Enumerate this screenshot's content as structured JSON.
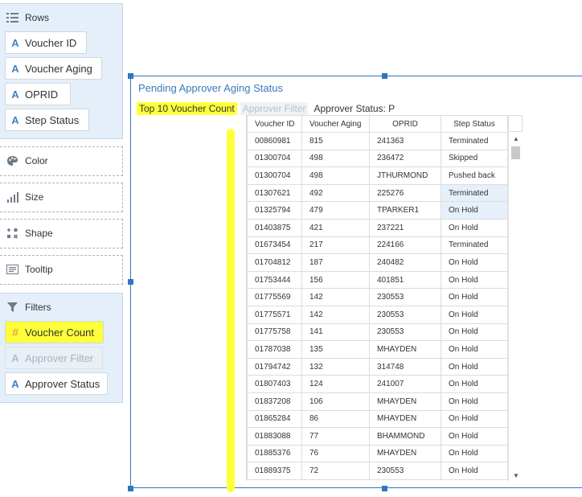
{
  "rows": {
    "header": "Rows",
    "items": [
      "Voucher ID",
      "Voucher Aging",
      "OPRID",
      "Step Status"
    ]
  },
  "marks": {
    "color": "Color",
    "size": "Size",
    "shape": "Shape",
    "tooltip": "Tooltip"
  },
  "filters": {
    "header": "Filters",
    "voucher_count": "Voucher Count",
    "approver_filter": "Approver Filter",
    "approver_status": "Approver Status"
  },
  "viz": {
    "title": "Pending Approver Aging Status",
    "filter_chip": "Top 10 Voucher Count",
    "disabled_chip": "Approver Filter",
    "status_chip": "Approver Status: P"
  },
  "table": {
    "columns": [
      "Voucher ID",
      "Voucher Aging",
      "OPRID",
      "Step Status"
    ],
    "rows": [
      [
        "00860981",
        "815",
        "241363",
        "Terminated"
      ],
      [
        "01300704",
        "498",
        "236472",
        "Skipped"
      ],
      [
        "01300704",
        "498",
        "JTHURMOND",
        "Pushed back"
      ],
      [
        "01307621",
        "492",
        "225276",
        "Terminated"
      ],
      [
        "01325794",
        "479",
        "TPARKER1",
        "On Hold"
      ],
      [
        "01403875",
        "421",
        "237221",
        "On Hold"
      ],
      [
        "01673454",
        "217",
        "224166",
        "Terminated"
      ],
      [
        "01704812",
        "187",
        "240482",
        "On Hold"
      ],
      [
        "01753444",
        "156",
        "401851",
        "On Hold"
      ],
      [
        "01775569",
        "142",
        "230553",
        "On Hold"
      ],
      [
        "01775571",
        "142",
        "230553",
        "On Hold"
      ],
      [
        "01775758",
        "141",
        "230553",
        "On Hold"
      ],
      [
        "01787038",
        "135",
        "MHAYDEN",
        "On Hold"
      ],
      [
        "01794742",
        "132",
        "314748",
        "On Hold"
      ],
      [
        "01807403",
        "124",
        "241007",
        "On Hold"
      ],
      [
        "01837208",
        "106",
        "MHAYDEN",
        "On Hold"
      ],
      [
        "01865284",
        "86",
        "MHAYDEN",
        "On Hold"
      ],
      [
        "01883088",
        "77",
        "BHAMMOND",
        "On Hold"
      ],
      [
        "01885376",
        "76",
        "MHAYDEN",
        "On Hold"
      ],
      [
        "01889375",
        "72",
        "230553",
        "On Hold"
      ]
    ]
  },
  "icons": {
    "field": "text-field-icon",
    "measure": "hash-measure-icon"
  },
  "colors": {
    "accent": "#2f76c0",
    "highlight": "#ffff3a",
    "panel": "#e4eff9"
  }
}
